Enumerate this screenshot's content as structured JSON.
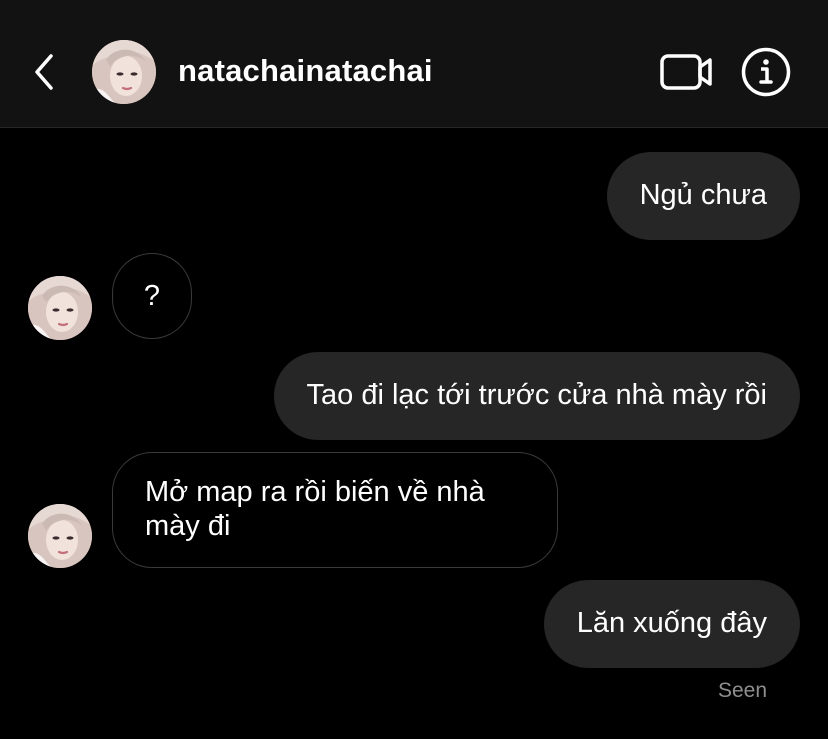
{
  "header": {
    "username": "natachainatachai",
    "back_icon": "chevron-left-icon",
    "avatar_icon": "profile-avatar",
    "video_icon": "video-camera-icon",
    "info_icon": "info-icon"
  },
  "messages": [
    {
      "direction": "outgoing",
      "text": "Ngủ chưa"
    },
    {
      "direction": "incoming",
      "text": "?"
    },
    {
      "direction": "outgoing",
      "text": "Tao đi lạc tới trước cửa nhà mày rồi"
    },
    {
      "direction": "incoming",
      "text": "Mở map ra rồi biến về nhà mày đi"
    },
    {
      "direction": "outgoing",
      "text": "Lăn xuống đây"
    }
  ],
  "status": {
    "seen_label": "Seen"
  },
  "colors": {
    "background": "#000000",
    "header_background": "#121212",
    "outgoing_bubble": "#262626",
    "incoming_border": "#3a3a3a",
    "seen_text": "#8e8e8e"
  }
}
